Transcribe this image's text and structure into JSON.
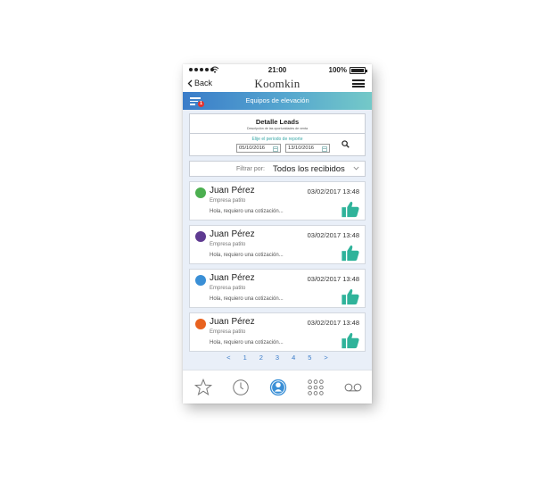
{
  "status_bar": {
    "time": "21:00",
    "battery": "100%"
  },
  "nav": {
    "back_label": "Back",
    "logo": "Koomkin"
  },
  "title_bar": {
    "title": "Equipos de elevación",
    "badge": "1"
  },
  "lead_box": {
    "title": "Detalle Leads",
    "subtitle": "Descripción de las oportunidades de venta",
    "period_label": "Elije el periodo de reporte",
    "date_from": "05/10/2016",
    "date_to": "13/10/2016"
  },
  "filter": {
    "label": "Filtrar por:",
    "value": "Todos los recibidos"
  },
  "leads": [
    {
      "name": "Juan Pérez",
      "date": "03/02/2017 13:48",
      "company": "Empresa patito",
      "message": "Hola, requiero una cotización...",
      "dot_color": "#4caf50"
    },
    {
      "name": "Juan Pérez",
      "date": "03/02/2017 13:48",
      "company": "Empresa patito",
      "message": "Hola, requiero una cotización...",
      "dot_color": "#5e3a91"
    },
    {
      "name": "Juan Pérez",
      "date": "03/02/2017 13:48",
      "company": "Empresa patito",
      "message": "Hola, requiero una cotización...",
      "dot_color": "#3a8fd6"
    },
    {
      "name": "Juan Pérez",
      "date": "03/02/2017 13:48",
      "company": "Empresa patito",
      "message": "Hola, requiero una cotización...",
      "dot_color": "#e8621f"
    }
  ],
  "pagination": {
    "prev": "<",
    "pages": [
      "1",
      "2",
      "3",
      "4",
      "5"
    ],
    "next": ">"
  },
  "colors": {
    "accent": "#3a7cc9",
    "like": "#2fb39a"
  },
  "tab_bar": {
    "icons": [
      "star-icon",
      "clock-icon",
      "user-icon",
      "grid-icon",
      "voicemail-icon"
    ]
  }
}
